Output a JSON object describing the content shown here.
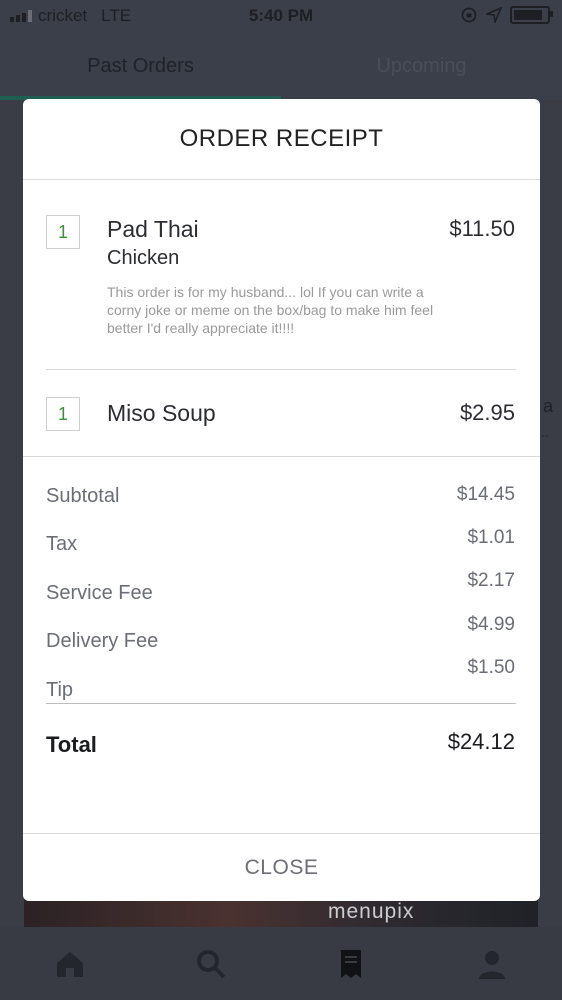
{
  "status_bar": {
    "carrier": "cricket",
    "network": "LTE",
    "time": "5:40 PM",
    "battery_level": 0.9
  },
  "tabs": [
    {
      "label": "Past Orders",
      "active": true
    },
    {
      "label": "Upcoming",
      "active": false
    }
  ],
  "background": {
    "right_text_1": "a",
    "right_text_2": "..",
    "watermark": "menupix"
  },
  "receipt": {
    "title": "ORDER RECEIPT",
    "items": [
      {
        "qty": "1",
        "name": "Pad Thai",
        "option": "Chicken",
        "note": "This order is for my husband... lol If you can write a corny joke or meme on the box/bag to make him feel better I'd really appreciate it!!!!",
        "price": "$11.50"
      },
      {
        "qty": "1",
        "name": "Miso Soup",
        "option": "",
        "note": "",
        "price": "$2.95"
      }
    ],
    "summary": [
      {
        "label": "Subtotal",
        "value": "$14.45"
      },
      {
        "label": "Tax",
        "value": "$1.01"
      },
      {
        "label": "Service Fee",
        "value": "$2.17"
      },
      {
        "label": "Delivery Fee",
        "value": "$4.99"
      },
      {
        "label": "Tip",
        "value": "$1.50"
      }
    ],
    "total_label": "Total",
    "total_value": "$24.12",
    "close_label": "CLOSE"
  },
  "bottom_nav": [
    {
      "icon": "home-icon"
    },
    {
      "icon": "search-icon"
    },
    {
      "icon": "receipt-icon",
      "active": true
    },
    {
      "icon": "account-icon"
    }
  ],
  "colors": {
    "accent": "#1f5f52",
    "qty_text": "#3e8e3e",
    "overlay_bg": "#3b3f4a"
  }
}
